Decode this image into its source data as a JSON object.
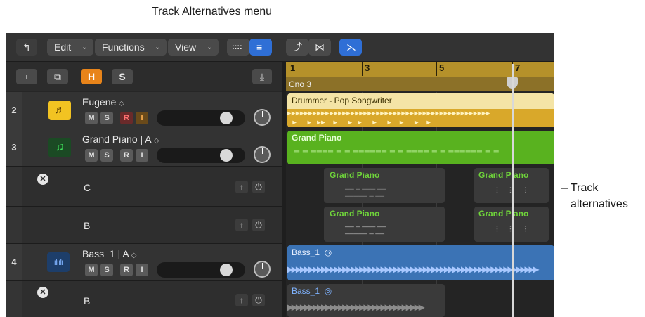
{
  "callouts": {
    "top": "Track Alternatives menu",
    "right_line1": "Track",
    "right_line2": "alternatives"
  },
  "toolbar": {
    "back_icon": "↰",
    "edit": "Edit",
    "functions": "Functions",
    "view": "View",
    "chevron": "⌄",
    "grid_icon": "::::",
    "list_icon": "≡",
    "curve_icon": "⤴",
    "bowtie_icon": "⋈",
    "snap_icon": "⋋"
  },
  "header": {
    "add": "+",
    "dup": "⧉",
    "h": "H",
    "s": "S",
    "catch": "⤓"
  },
  "ruler": {
    "bars": [
      "1",
      "3",
      "5",
      "7"
    ],
    "marker_label": "Cno 3"
  },
  "buttons": {
    "m": "M",
    "s": "S",
    "r": "R",
    "i": "I",
    "up": "↑",
    "power": "⏻",
    "remove": "✕",
    "updown": "◇"
  },
  "tracks": [
    {
      "num": "2",
      "name": "Eugene"
    },
    {
      "num": "3",
      "name": "Grand Piano | A"
    },
    {
      "num": "4",
      "name": "Bass_1 | A"
    }
  ],
  "alternatives": {
    "piano_c": "C",
    "piano_b": "B",
    "bass_b": "B"
  },
  "regions": {
    "drummer": "Drummer - Pop Songwriter",
    "grand_piano": "Grand Piano",
    "bass": "Bass_1"
  },
  "colors": {
    "drummer": "#f4e4a6",
    "piano": "#59b21f",
    "bass": "#3b73b5",
    "ruler": "#b5912a",
    "h_button": "#e8841a"
  }
}
